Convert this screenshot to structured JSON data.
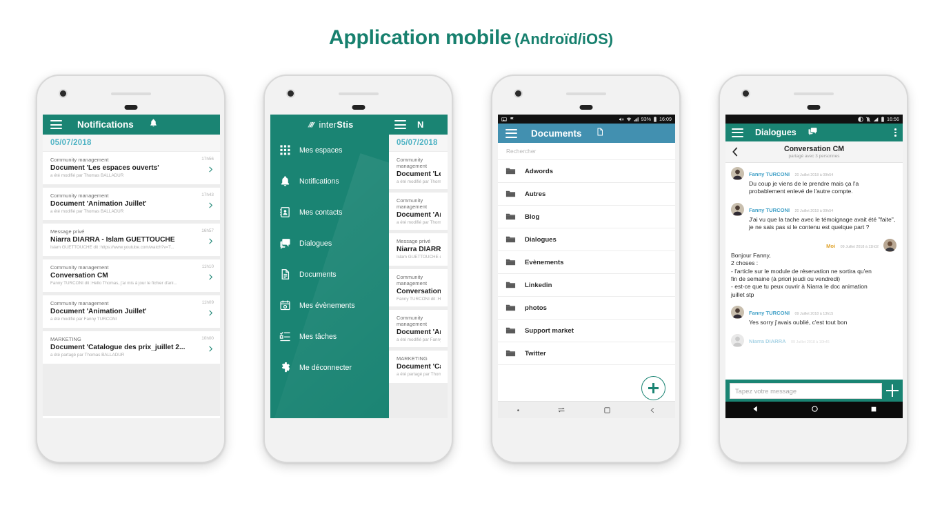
{
  "title": {
    "main": "Application mobile",
    "sub": "(Androïd/iOS)",
    "accent": "#17806e"
  },
  "phone1": {
    "appbar": {
      "title": "Notifications",
      "menu_icon": "hamburger-icon",
      "bell_icon": "bell-icon"
    },
    "date": "05/07/2018",
    "notifications": [
      {
        "category": "Community management",
        "title": "Document 'Les espaces ouverts'",
        "sub": "a été modifié par Thomas BALLADUR",
        "time": "17h56"
      },
      {
        "category": "Community management",
        "title": "Document 'Animation Juillet'",
        "sub": "a été modifié par Thomas BALLADUR",
        "time": "17h43"
      },
      {
        "category": "Message privé",
        "title": "Niarra DIARRA - Islam GUETTOUCHE",
        "sub": "Islam GUETTOUCHE dit :https://www.youtube.com/watch?v=T...",
        "time": "16h57"
      },
      {
        "category": "Community management",
        "title": "Conversation CM",
        "sub": "Fanny TURCONI dit :Hello Thomas, j'ai mis à jour le fichier d'ani...",
        "time": "11h10"
      },
      {
        "category": "Community management",
        "title": "Document 'Animation Juillet'",
        "sub": "a été modifié par Fanny TURCONI",
        "time": "11h09"
      },
      {
        "category": "MARKETING",
        "title": "Document 'Catalogue des prix_juillet 2...",
        "sub": "a été partagé par Thomas BALLADUR",
        "time": "10h00"
      }
    ]
  },
  "phone2": {
    "brand": {
      "pre": "inter",
      "post": "Stis",
      "logo_icon": "interstis-logo-icon"
    },
    "peek_title": "N",
    "menu": [
      {
        "label": "Mes espaces",
        "icon": "grid-icon"
      },
      {
        "label": "Notifications",
        "icon": "bell-icon"
      },
      {
        "label": "Mes contacts",
        "icon": "contacts-icon"
      },
      {
        "label": "Dialogues",
        "icon": "chat-icon"
      },
      {
        "label": "Documents",
        "icon": "document-icon"
      },
      {
        "label": "Mes évènements",
        "icon": "calendar-icon"
      },
      {
        "label": "Mes tâches",
        "icon": "tasks-icon"
      },
      {
        "label": "Me déconnecter",
        "icon": "gear-icon"
      }
    ]
  },
  "phone3": {
    "statusbar": {
      "battery": "93%",
      "time": "16:09",
      "icons_left": [
        "image-icon",
        "flag-icon"
      ],
      "icons_right": [
        "mute-icon",
        "wifi-icon",
        "signal-icon",
        "battery-icon"
      ]
    },
    "appbar": {
      "title": "Documents",
      "menu_icon": "hamburger-icon",
      "new_doc_icon": "new-document-icon"
    },
    "search_placeholder": "Rechercher",
    "folders": [
      "Adwords",
      "Autres",
      "Blog",
      "Dialogues",
      "Evènements",
      "Linkedin",
      "photos",
      "Support market",
      "Twitter"
    ],
    "fab": "add-button",
    "navbar": [
      "dot-icon",
      "switch-icon",
      "square-icon",
      "back-icon"
    ]
  },
  "phone4": {
    "statusbar": {
      "time": "16:56",
      "icons_right": [
        "dnd-icon",
        "no-sim-icon",
        "signal-icon",
        "battery-icon"
      ]
    },
    "appbar": {
      "title": "Dialogues",
      "menu_icon": "hamburger-icon",
      "chat_icon": "chat-icon",
      "more_icon": "kebab-icon"
    },
    "conversation": {
      "title": "Conversation CM",
      "subtitle": "partagé avec 3 personnes",
      "back_icon": "chevron-left-icon"
    },
    "messages": [
      {
        "author": "Fanny TURCONI",
        "date": "20 Juillet 2018 à 09h54",
        "text": "Du coup je viens de le prendre mais ça l'a probablement enlevé de l'autre compte.",
        "side": "left"
      },
      {
        "author": "Fanny TURCONI",
        "date": "20 Juillet 2018 à 09h54",
        "text": "J'ai vu que la tache avec le témoignage avait été \"faite\", je ne sais pas si le contenu est quelque part ?",
        "side": "left"
      },
      {
        "author": "Moi",
        "date": "09 Juillet 2018 à 11h02",
        "text": "Bonjour Fanny,\n2 choses :\n- l'article sur le module de réservation ne sortira qu'en fin de semaine (à priori jeudi ou vendredi)\n- est-ce que tu peux ouvrir à Niarra le doc animation juillet stp",
        "side": "right"
      },
      {
        "author": "Fanny TURCONI",
        "date": "09 Juillet 2018 à 13h15",
        "text": "Yes sorry j'avais oublié, c'est tout bon",
        "side": "left"
      },
      {
        "author": "Niarra DIARRA",
        "date": "09 Juillet 2018 à 10h45",
        "text": "",
        "side": "left"
      }
    ],
    "composer": {
      "placeholder": "Tapez votre message",
      "add_icon": "plus-icon"
    },
    "navbar": [
      "back-triangle-icon",
      "home-circle-icon",
      "recents-square-icon"
    ]
  },
  "colors": {
    "teal": "#1a8473",
    "blue": "#4290b0",
    "date_blue": "#4fb3c4",
    "author_blue": "#3f9fc6",
    "me_orange": "#e0a32b"
  }
}
